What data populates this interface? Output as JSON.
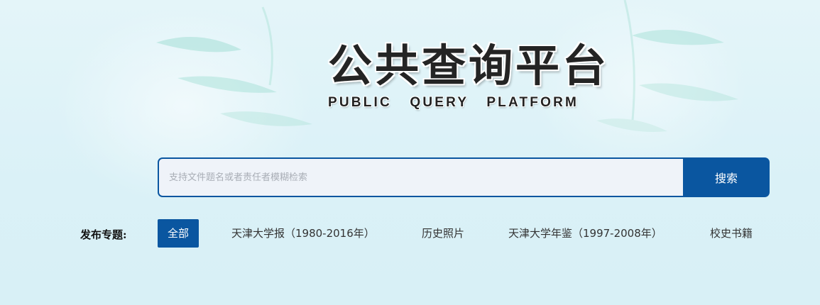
{
  "header": {
    "title_cn": "公共查询平台",
    "title_en": "PUBLIC   QUERY   PLATFORM"
  },
  "search": {
    "placeholder": "支持文件题名或者责任者模糊检索",
    "value": "",
    "button_label": "搜索"
  },
  "topics": {
    "label": "发布专题:",
    "items": [
      {
        "label": "全部",
        "active": true
      },
      {
        "label": "天津大学报（1980-2016年）",
        "active": false
      },
      {
        "label": "历史照片",
        "active": false
      },
      {
        "label": "天津大学年鉴（1997-2008年）",
        "active": false
      },
      {
        "label": "校史书籍",
        "active": false
      }
    ]
  },
  "colors": {
    "accent": "#0a56a0",
    "background": "#dcf2f8",
    "title_text": "#242424"
  }
}
